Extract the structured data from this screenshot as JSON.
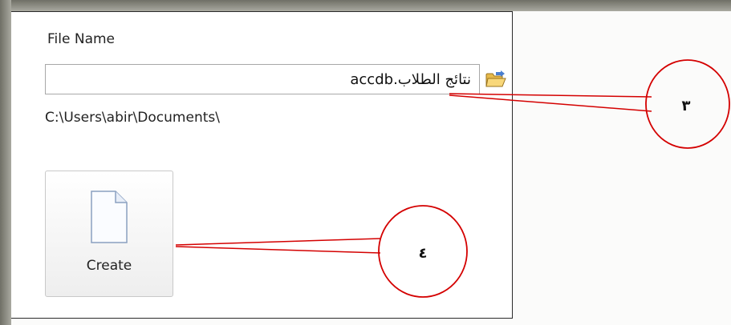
{
  "file_name": {
    "label": "File Name",
    "value": "نتائج الطلاب.accdb"
  },
  "path": "C:\\Users\\abir\\Documents\\",
  "create_button": {
    "label": "Create",
    "icon": "document-icon"
  },
  "browse_icon": "folder-open-icon",
  "callouts": [
    "٣",
    "٤"
  ],
  "colors": {
    "callout": "#d40000",
    "frame": "#8a8a80",
    "border": "#2a2a2a"
  }
}
